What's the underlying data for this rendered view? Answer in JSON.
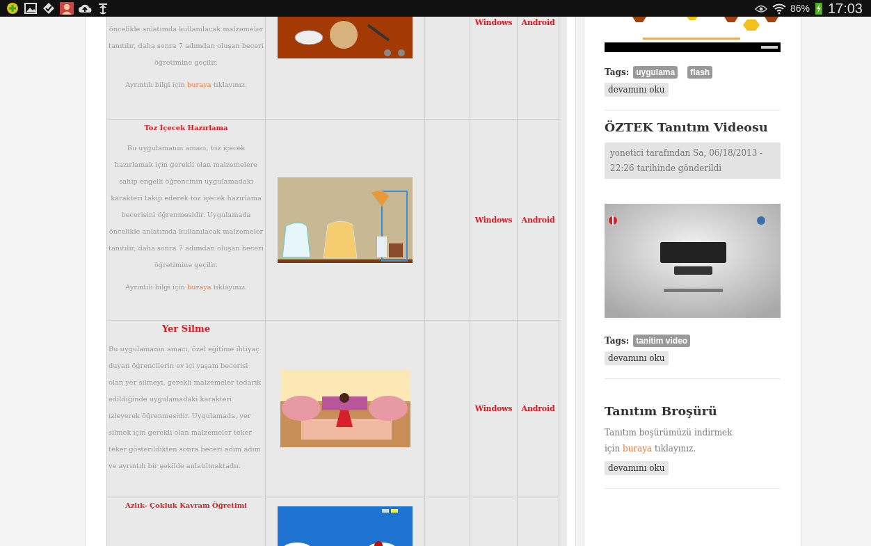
{
  "status_bar": {
    "battery": "86%",
    "time": "17:03"
  },
  "table": {
    "rows": [
      {
        "title": null,
        "kind": "center",
        "description": "öncelikle anlatımda kullanılacak malzemeler tanıtılır, daha sonra 7 adımdan oluşan beceri öğretimine geçilir.",
        "info": {
          "before": "Ayrıntılı bilgi için",
          "link": "buraya",
          "after": "tıklayınız."
        },
        "platforms": [
          "Windows",
          "Android"
        ]
      },
      {
        "title": "Toz İçecek Hazırlama",
        "kind": "center",
        "description": "Bu uygulamanın amacı, toz içecek hazırlamak için gerekli olan malzemelere sahip engelli öğrencinin uygulamadaki karakteri takip ederek toz içecek hazırlama becerisini öğrenmesidir. Uygulamada öncelikle anlatımda kullanılacak malzemeler tanıtılır, daha sonra 7 adımdan oluşan beceri öğretimine geçilir.",
        "info": {
          "before": "Ayrıntılı bilgi için",
          "link": "buraya",
          "after": "tıklayınız."
        },
        "platforms": [
          "Windows",
          "Android"
        ]
      },
      {
        "title": "Yer Silme",
        "kind": "left",
        "description": "Bu uygulamanın amacı, özel eğitime ihtiyaç duyan öğrencilerin ev içi yaşam becerisi olan yer silmeyi, gerekli malzemeler tedarik edildiğinde uygulamadaki karakteri izleyerek öğrenmesidir. Uygulamada, yer silmek için gerekli olan malzemeler teker teker gösterildikten sonra beceri adım adım ve ayrıntılı bir şekilde anlatılmaktadır.",
        "platforms": [
          "Windows",
          "Android"
        ]
      },
      {
        "title": "Azlık- Çokluk Kavram Öğretimi",
        "kind": "center"
      }
    ]
  },
  "sidebar": {
    "posts": [
      {
        "tags_label": "Tags:",
        "tags": [
          "uygulama",
          "flash"
        ],
        "read_more": "devamını oku"
      },
      {
        "heading": "ÖZTEK Tanıtım Videosu",
        "meta": "yonetici tarafından Sa, 06/18/2013 - 22:26 tarihinde gönderildi",
        "tags_label": "Tags:",
        "tags": [
          "tanitim video"
        ],
        "read_more": "devamını oku"
      },
      {
        "heading": "Tanıtım Broşürü",
        "text": {
          "before": "Tanıtım boşürümüzü indirmek için",
          "link": "buraya",
          "after": "tıklayınız."
        },
        "read_more": "devamını oku"
      }
    ]
  }
}
